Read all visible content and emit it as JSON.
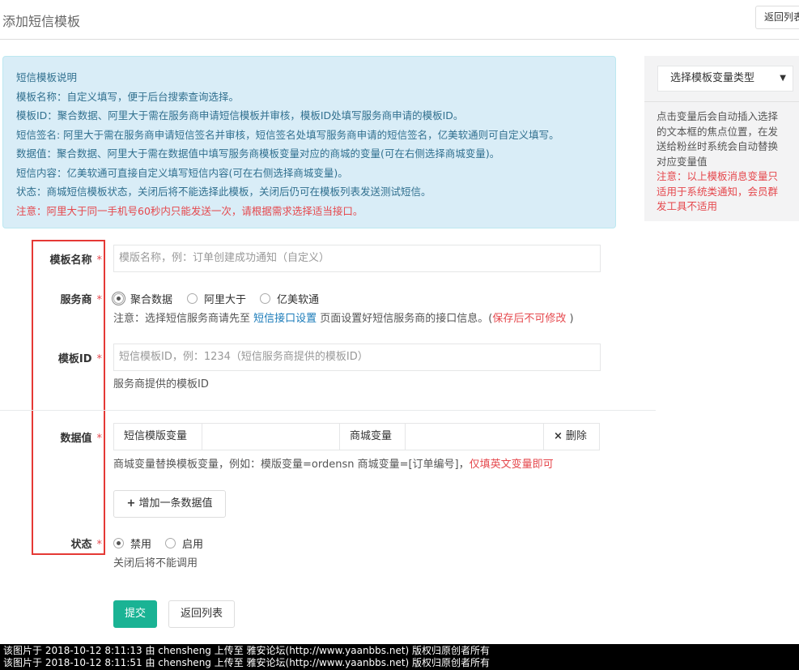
{
  "page": {
    "title": "添加短信模板",
    "back_top_label": "返回列表"
  },
  "info": {
    "heading": "短信模板说明",
    "lines": [
      "模板名称：自定义填写，便于后台搜索查询选择。",
      "模板ID：聚合数据、阿里大于需在服务商申请短信模板并审核，模板ID处填写服务商申请的模板ID。",
      "短信签名: 阿里大于需在服务商申请短信签名并审核，短信签名处填写服务商申请的短信签名，亿美软通则可自定义填写。",
      "数据值：聚合数据、阿里大于需在数据值中填写服务商模板变量对应的商城的变量(可在右侧选择商城变量)。",
      "短信内容：亿美软通可直接自定义填写短信内容(可在右侧选择商城变量)。",
      "状态：商城短信模板状态，关闭后将不能选择此模板，关闭后仍可在模板列表发送测试短信。"
    ],
    "warning": "注意：阿里大于同一手机号60秒内只能发送一次，请根据需求选择适当接口。"
  },
  "side": {
    "select_label": "选择模板变量类型",
    "caret": "▼",
    "help_text": "点击变量后会自动插入选择的文本框的焦点位置，在发送给粉丝时系统会自动替换对应变量值",
    "warning": "注意：以上模板消息变量只适用于系统类通知，会员群发工具不适用"
  },
  "form": {
    "required_mark": "*",
    "name": {
      "label": "模板名称",
      "placeholder": "模版名称，例：订单创建成功通知（自定义）"
    },
    "provider": {
      "label": "服务商",
      "options": [
        {
          "label": "聚合数据",
          "checked": true
        },
        {
          "label": "阿里大于",
          "checked": false
        },
        {
          "label": "亿美软通",
          "checked": false
        }
      ],
      "help_prefix": "注意：选择短信服务商请先至 ",
      "help_link": "短信接口设置",
      "help_middle": " 页面设置好短信服务商的接口信息。(",
      "help_warn": "保存后不可修改",
      "help_suffix": " )"
    },
    "template_id": {
      "label": "模板ID",
      "placeholder": "短信模板ID，例：1234（短信服务商提供的模板ID）",
      "help": "服务商提供的模板ID"
    },
    "data_value": {
      "label": "数据值",
      "sms_var_label": "短信模版变量",
      "shop_var_label": "商城变量",
      "delete_label": "删除",
      "delete_icon": "×",
      "help_text": "商城变量替换模板变量，例如：模版变量=ordensn 商城变量=[订单编号]，",
      "help_warn": "仅填英文变量即可",
      "add_label": "增加一条数据值",
      "add_icon": "+"
    },
    "status": {
      "label": "状态",
      "options": [
        {
          "label": "禁用",
          "checked": true
        },
        {
          "label": "启用",
          "checked": false
        }
      ],
      "help": "关闭后将不能调用"
    },
    "submit_label": "提交",
    "back_label": "返回列表"
  },
  "watermark": [
    "该图片于 2018-10-12 8:11:13 由 chensheng 上传至 雅安论坛(http://www.yaanbbs.net) 版权归原创者所有",
    "该图片于 2018-10-12 8:11:51 由 chensheng 上传至 雅安论坛(http://www.yaanbbs.net) 版权归原创者所有"
  ],
  "colors": {
    "primary": "#1ab394",
    "info_bg": "#d9edf7",
    "warning": "#e5484d",
    "link": "#1a7bb9",
    "highlight_frame": "#e53935"
  }
}
